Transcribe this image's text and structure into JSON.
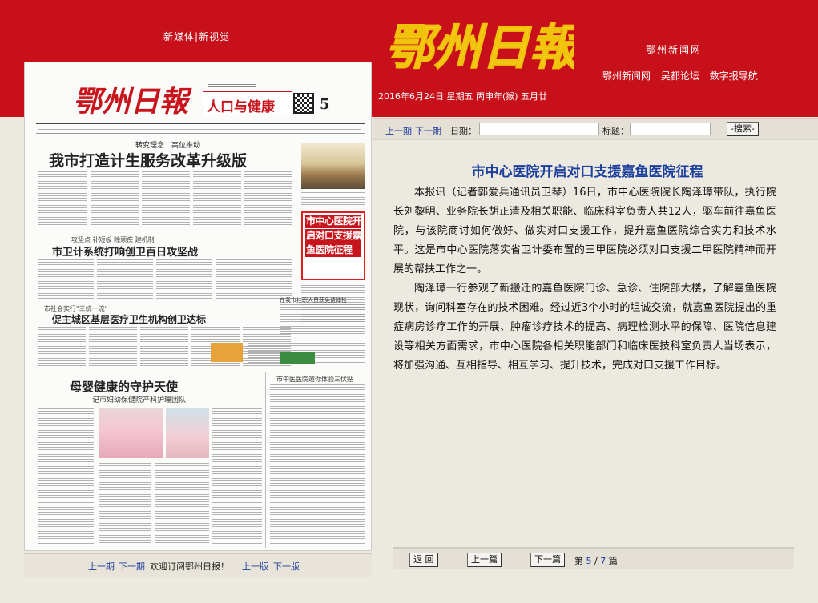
{
  "header": {
    "tagline": "新媒体|新视觉",
    "logo_text": "鄂州日報",
    "site_name": "鄂州新闻网",
    "links": [
      "鄂州新闻网",
      "吴都论坛",
      "数字报导航"
    ],
    "date": "2016年6月24日 星期五 丙申年(猴) 五月廿"
  },
  "newspaper_page": {
    "masthead": "鄂州日報",
    "section_title": "人口与健康",
    "page_number": "5",
    "kicker1": "转变理念　高位推动",
    "headline1": "我市打造计生服务改革升级版",
    "kicker2": "攻坚点 补短板 除顽疾 建机制",
    "headline2": "市卫计系统打响创卫百日攻坚战",
    "kicker3": "市社会实行\"三统一流\"",
    "headline3": "促主城区基层医疗卫生机构创卫达标",
    "headline4": "母婴健康的守护天使",
    "subhead4": "——记市妇幼保健院产科护理团队",
    "headline5": "在我市挂职人员获免费体检",
    "headline6": "市中医医院邀你体验三伏贴",
    "highlight_title": "市中心医院开启对口支援嘉鱼医院征程"
  },
  "nav": {
    "prev_issue": "上一期",
    "next_issue": "下一期",
    "date_label": "日期：",
    "date_value": "",
    "title_label": "标题：",
    "title_value": "",
    "search_button": "-搜索-"
  },
  "article": {
    "title": "市中心医院开启对口支援嘉鱼医院征程",
    "paragraphs": [
      "本报讯（记者郭爱兵通讯员卫琴）16日，市中心医院院长陶泽璋带队，执行院长刘黎明、业务院长胡正清及相关职能、临床科室负责人共12人，驱车前往嘉鱼医院，与该院商讨如何做好、做实对口支援工作，提升嘉鱼医院综合实力和技术水平。这是市中心医院落实省卫计委布置的三甲医院必须对口支援二甲医院精神而开展的帮扶工作之一。",
      "陶泽璋一行参观了新搬迁的嘉鱼医院门诊、急诊、住院部大楼，了解嘉鱼医院现状，询问科室存在的技术困难。经过近3个小时的坦诚交流，就嘉鱼医院提出的重症病房诊疗工作的开展、肿瘤诊疗技术的提高、病理检测水平的保障、医院信息建设等相关方面需求，市中心医院各相关职能部门和临床医技科室负责人当场表示，将加强沟通、互相指导、相互学习、提升技术，完成对口支援工作目标。"
    ]
  },
  "bottom_nav": {
    "back_button": "返 回",
    "prev_article": "上一篇",
    "next_article": "下一篇",
    "page_prefix": "第",
    "current": "5",
    "separator": "/",
    "total": "7",
    "page_suffix": "篇"
  },
  "left_bottom": {
    "prev_issue": "上一期",
    "next_issue": "下一期",
    "subscribe": "欢迎订阅鄂州日报！",
    "prev_page": "上一版",
    "next_page": "下一版"
  },
  "colors": {
    "header_red": "#c8101b",
    "link_blue": "#1c3c9c",
    "title_blue": "#1c3f9e",
    "highlight_red": "#e51a1a"
  }
}
